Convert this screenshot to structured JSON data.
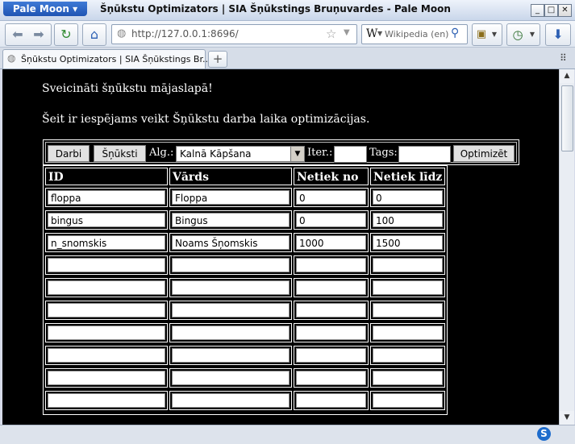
{
  "window": {
    "app_button": "Pale Moon",
    "title": "Šņūkstu Optimizators | SIA Šņūkstings Bruņuvardes - Pale Moon",
    "controls": [
      "_",
      "□",
      "✕"
    ]
  },
  "navbar": {
    "url": "http://127.0.0.1:8696/",
    "search_placeholder": "Wikipedia (en)",
    "search_engine_icon": "W"
  },
  "tabs": [
    {
      "label": "Šņūkstu Optimizators | SIA Šņūkstings Br..."
    }
  ],
  "page": {
    "welcome": "Sveicināti šņūkstu mājaslapā!",
    "intro": "Šeit ir iespējams veikt Šņūkstu darba laika optimizācijas.",
    "toolbar": {
      "darbi_button": "Darbi",
      "snuksti_button": "Šņūksti",
      "alg_label": "Alg.:",
      "alg_value": "Kalnā Kāpšana",
      "iter_label": "Iter.:",
      "iter_value": "",
      "tags_label": "Tags:",
      "tags_value": "",
      "optimize_button": "Optimizēt"
    },
    "table": {
      "headers": [
        "ID",
        "Vārds",
        "Netiek no",
        "Netiek līdz"
      ],
      "rows": [
        [
          "floppa",
          "Floppa",
          "0",
          "0"
        ],
        [
          "bingus",
          "Bingus",
          "0",
          "100"
        ],
        [
          "n_snomskis",
          "Noams Šņomskis",
          "1000",
          "1500"
        ],
        [
          "",
          "",
          "",
          ""
        ],
        [
          "",
          "",
          "",
          ""
        ],
        [
          "",
          "",
          "",
          ""
        ],
        [
          "",
          "",
          "",
          ""
        ],
        [
          "",
          "",
          "",
          ""
        ],
        [
          "",
          "",
          "",
          ""
        ],
        [
          "",
          "",
          "",
          ""
        ]
      ]
    }
  }
}
